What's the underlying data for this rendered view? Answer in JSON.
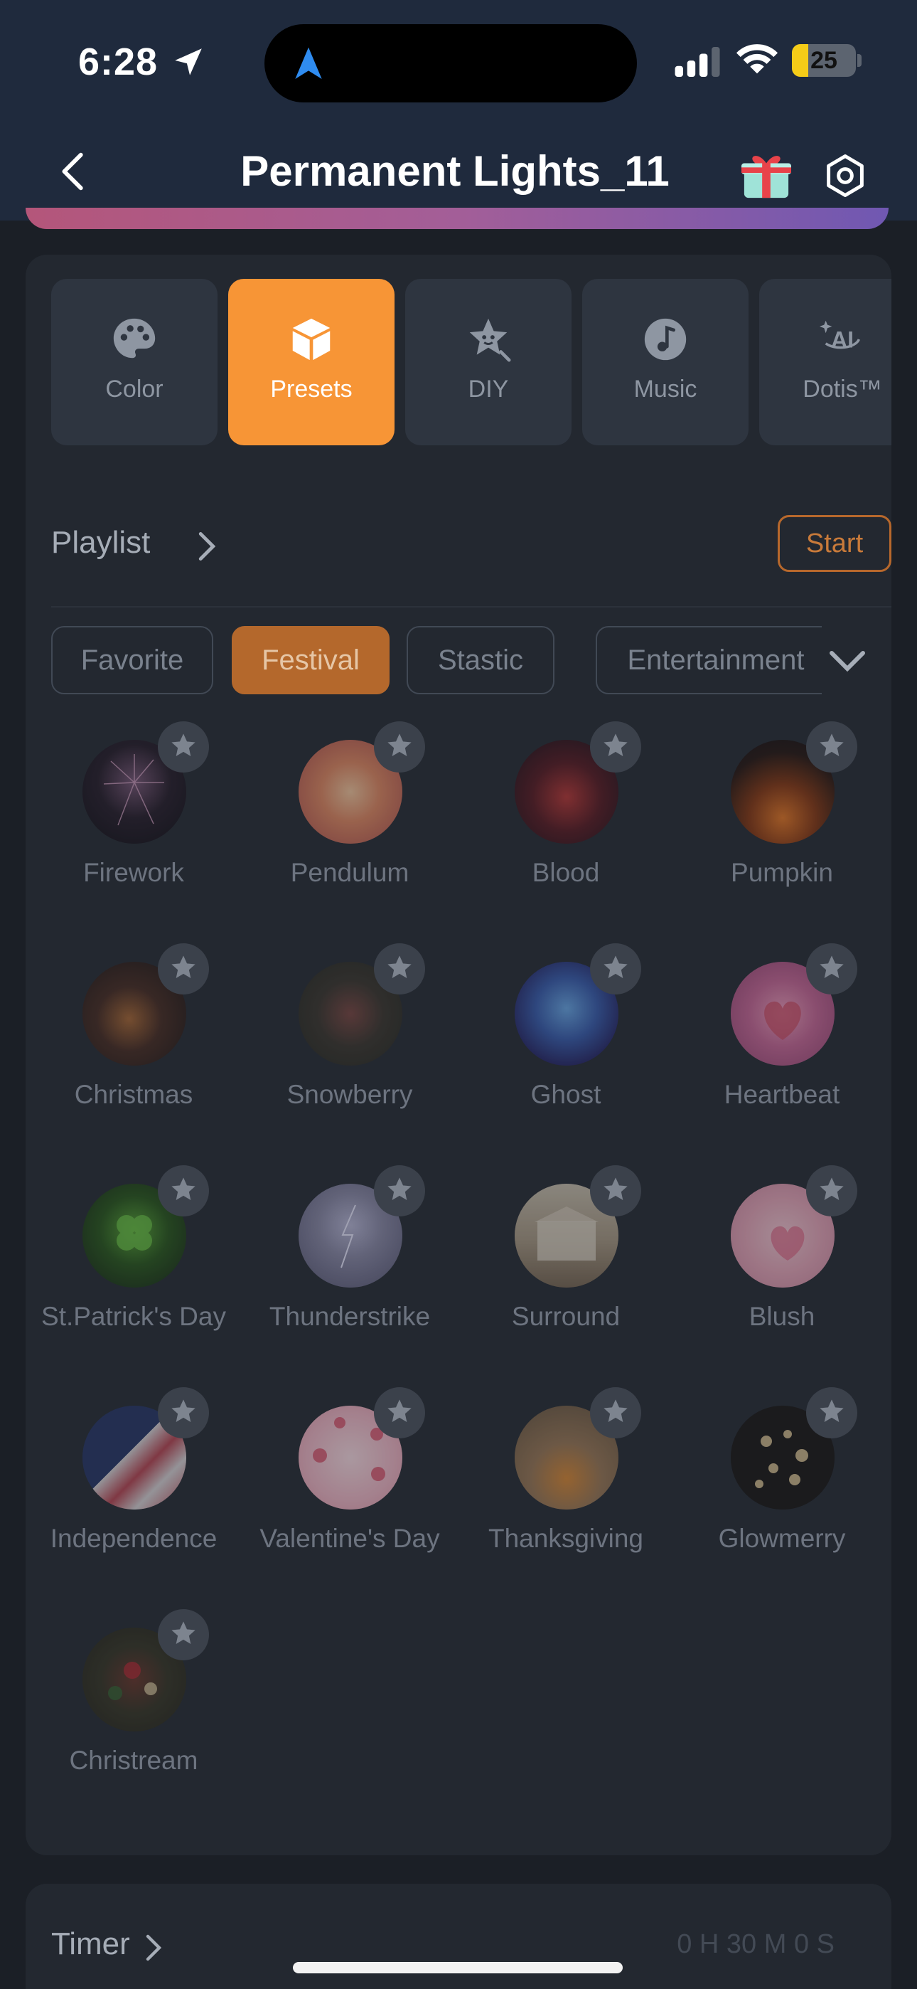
{
  "status_bar": {
    "time": "6:28",
    "battery": "25",
    "battery_fraction": 0.25
  },
  "header": {
    "title": "Permanent Lights_11",
    "back_icon": "chevron-left-icon",
    "gift_icon": "gift-icon",
    "settings_icon": "hexagon-gear-icon"
  },
  "mode_tabs": [
    {
      "label": "Color",
      "icon": "palette-icon",
      "active": false
    },
    {
      "label": "Presets",
      "icon": "cube-icon",
      "active": true
    },
    {
      "label": "DIY",
      "icon": "star-face-icon",
      "active": false
    },
    {
      "label": "Music",
      "icon": "music-note-icon",
      "active": false
    },
    {
      "label": "Dotis™",
      "icon": "ai-icon",
      "active": false
    }
  ],
  "playlist": {
    "label": "Playlist",
    "start_label": "Start"
  },
  "categories": [
    {
      "label": "Favorite",
      "active": false
    },
    {
      "label": "Festival",
      "active": true
    },
    {
      "label": "Stastic",
      "active": false
    },
    {
      "label": "Entertainment",
      "active": false
    }
  ],
  "presets": [
    {
      "label": "Firework"
    },
    {
      "label": "Pendulum"
    },
    {
      "label": "Blood"
    },
    {
      "label": "Pumpkin"
    },
    {
      "label": "Christmas"
    },
    {
      "label": "Snowberry"
    },
    {
      "label": "Ghost"
    },
    {
      "label": "Heartbeat"
    },
    {
      "label": "St.Patrick's Day"
    },
    {
      "label": "Thunderstrike"
    },
    {
      "label": "Surround"
    },
    {
      "label": "Blush"
    },
    {
      "label": "Independence"
    },
    {
      "label": "Valentine's Day"
    },
    {
      "label": "Thanksgiving"
    },
    {
      "label": "Glowmerry"
    },
    {
      "label": "Christream"
    }
  ],
  "timer": {
    "label": "Timer",
    "value": "0 H 30 M 0 S"
  },
  "colors": {
    "accent": "#f79536",
    "accent_muted": "#b4682c",
    "panel": "#232830",
    "header": "#1f2a3d"
  }
}
